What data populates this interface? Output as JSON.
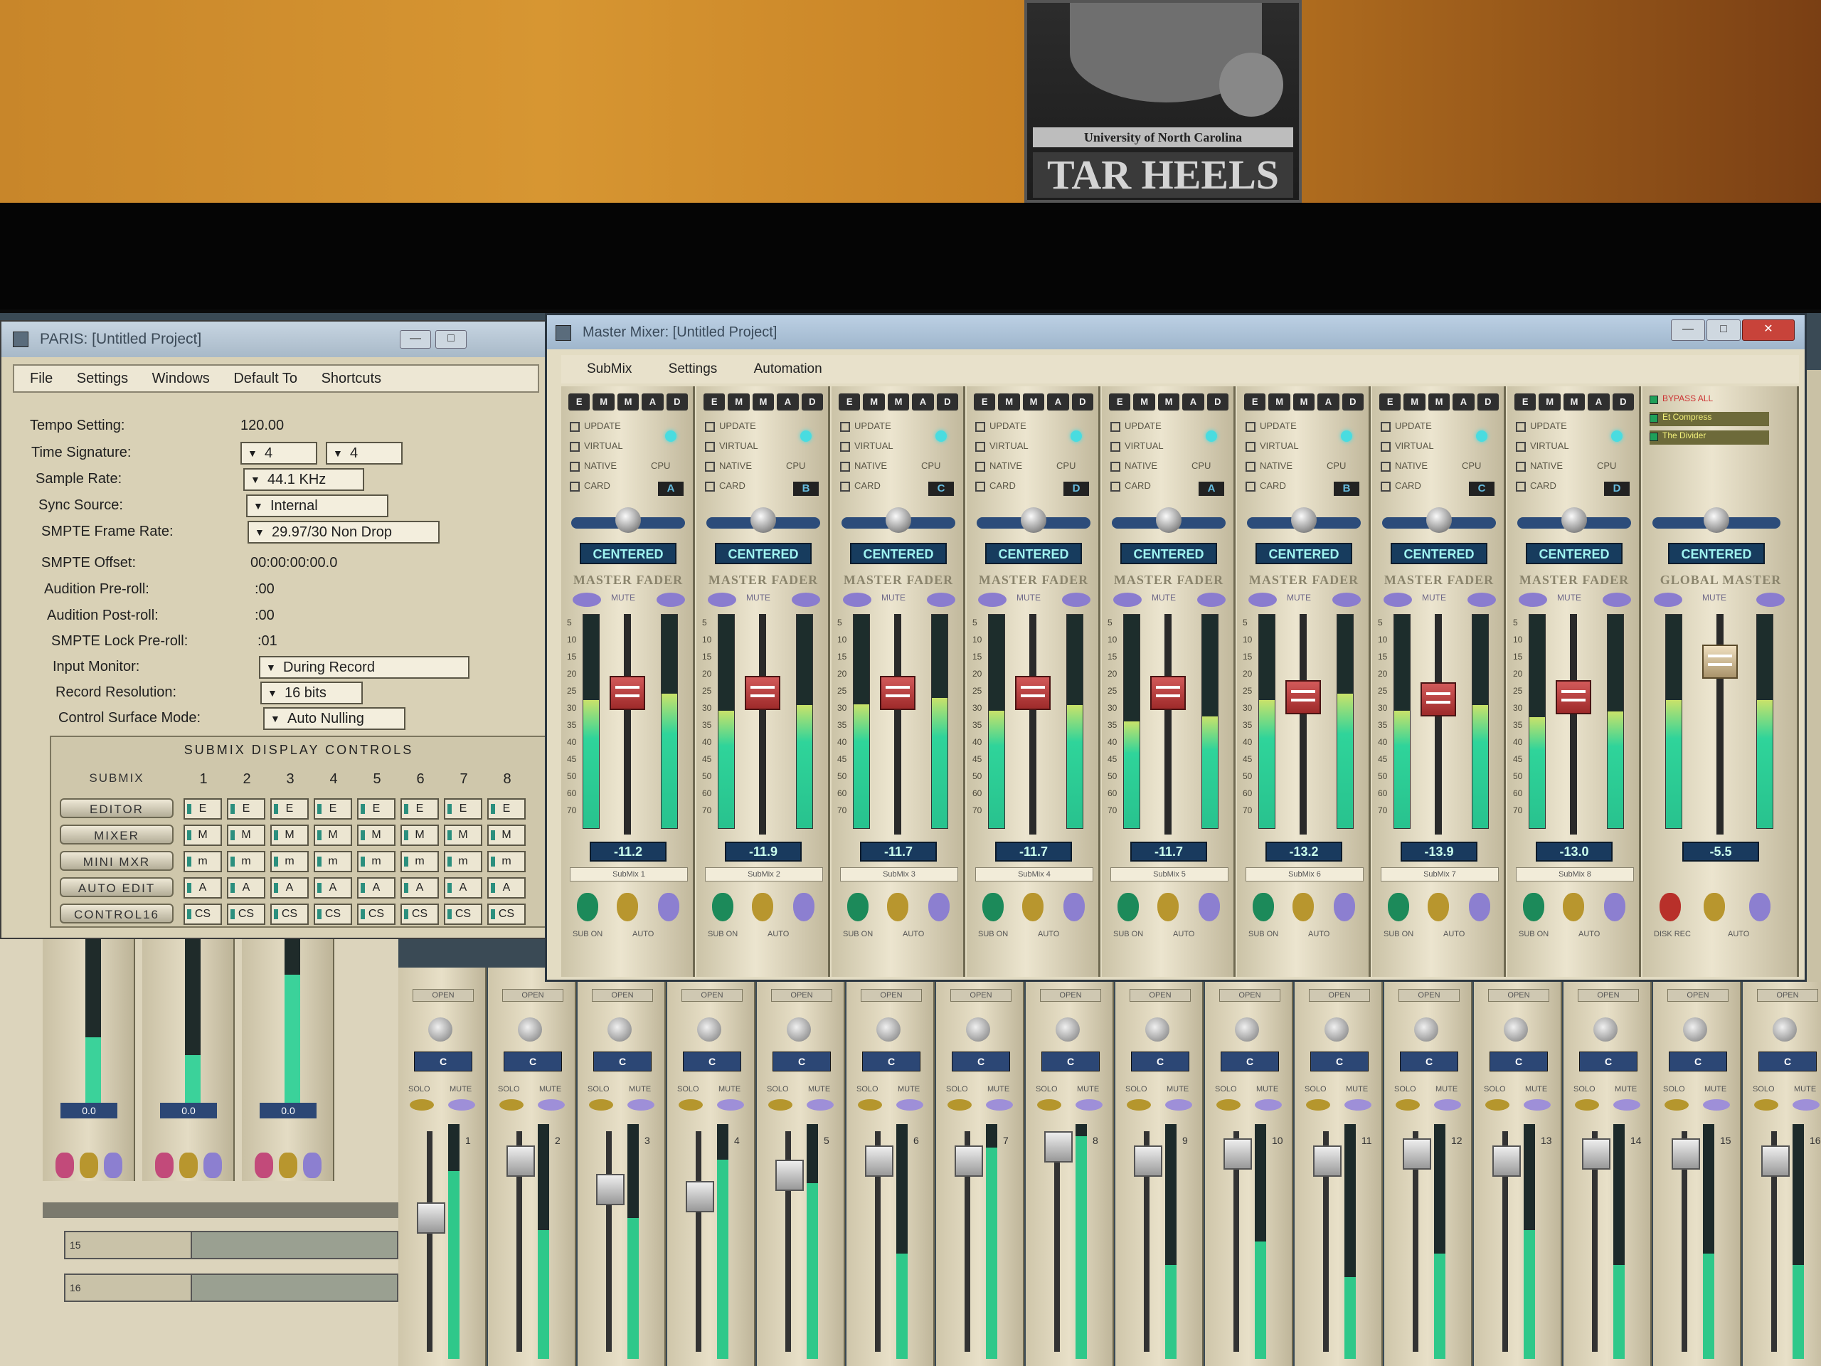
{
  "photo": {
    "poster": {
      "line1": "University of North Carolina",
      "line2": "TAR HEELS"
    }
  },
  "paris_window": {
    "title": "PARIS: [Untitled Project]",
    "controls": {
      "minimize": "—",
      "maximize": "□"
    },
    "menu": [
      "File",
      "Settings",
      "Windows",
      "Default To",
      "Shortcuts"
    ],
    "settings": [
      {
        "label": "Tempo Setting:",
        "value": "120.00",
        "kind": "text"
      },
      {
        "label": "Time Signature:",
        "value": "4",
        "value2": "4",
        "kind": "dual"
      },
      {
        "label": "Sample Rate:",
        "value": "44.1 KHz",
        "kind": "dropdown"
      },
      {
        "label": "Sync Source:",
        "value": "Internal",
        "kind": "dropdown"
      },
      {
        "label": "SMPTE Frame Rate:",
        "value": "29.97/30 Non Drop",
        "kind": "dropdown"
      },
      {
        "label": "SMPTE Offset:",
        "value": "00:00:00:00.0",
        "kind": "text"
      },
      {
        "label": "Audition Pre-roll:",
        "value": ":00",
        "kind": "text"
      },
      {
        "label": "Audition Post-roll:",
        "value": ":00",
        "kind": "text"
      },
      {
        "label": "SMPTE Lock Pre-roll:",
        "value": ":01",
        "kind": "text"
      },
      {
        "label": "Input Monitor:",
        "value": "During Record",
        "kind": "dropdown"
      },
      {
        "label": "Record Resolution:",
        "value": "16 bits",
        "kind": "dropdown"
      },
      {
        "label": "Control Surface Mode:",
        "value": "Auto Nulling",
        "kind": "dropdown"
      }
    ],
    "submix_panel": {
      "header": "SUBMIX  DISPLAY  CONTROLS",
      "row_header": "SUBMIX",
      "columns": [
        "1",
        "2",
        "3",
        "4",
        "5",
        "6",
        "7",
        "8"
      ],
      "rows": [
        {
          "label": "EDITOR",
          "cell": "E"
        },
        {
          "label": "MIXER",
          "cell": "M"
        },
        {
          "label": "MINI MXR",
          "cell": "m"
        },
        {
          "label": "AUTO EDIT",
          "cell": "A"
        },
        {
          "label": "CONTROL16",
          "cell": "CS"
        }
      ]
    }
  },
  "master_window": {
    "title": "Master Mixer: [Untitled Project]",
    "controls": {
      "minimize": "—",
      "maximize": "□",
      "close": "✕"
    },
    "menu": [
      "SubMix",
      "Settings",
      "Automation"
    ],
    "emmad": [
      "E",
      "M",
      "M",
      "A",
      "D"
    ],
    "options": [
      "UPDATE",
      "VIRTUAL",
      "NATIVE",
      "CARD"
    ],
    "cpu_label": "CPU",
    "pan_label": "CENTERED",
    "fader_title": "MASTER FADER",
    "mute_label": "MUTE",
    "scale": [
      "5",
      "10",
      "15",
      "20",
      "25",
      "30",
      "35",
      "40",
      "45",
      "50",
      "60",
      "70"
    ],
    "sub_on_label": "SUB ON",
    "auto_label": "AUTO",
    "strips": [
      {
        "card": "A",
        "db": "-11.2",
        "name": "SubMix 1",
        "fader_level": 0.72,
        "meter_level": 0.6
      },
      {
        "card": "B",
        "db": "-11.9",
        "name": "SubMix 2",
        "fader_level": 0.72,
        "meter_level": 0.55
      },
      {
        "card": "C",
        "db": "-11.7",
        "name": "SubMix 3",
        "fader_level": 0.72,
        "meter_level": 0.58
      },
      {
        "card": "D",
        "db": "-11.7",
        "name": "SubMix 4",
        "fader_level": 0.72,
        "meter_level": 0.55
      },
      {
        "card": "A",
        "db": "-11.7",
        "name": "SubMix 5",
        "fader_level": 0.72,
        "meter_level": 0.5
      },
      {
        "card": "B",
        "db": "-13.2",
        "name": "SubMix 6",
        "fader_level": 0.7,
        "meter_level": 0.6
      },
      {
        "card": "C",
        "db": "-13.9",
        "name": "SubMix 7",
        "fader_level": 0.69,
        "meter_level": 0.55
      },
      {
        "card": "D",
        "db": "-13.0",
        "name": "SubMix 8",
        "fader_level": 0.7,
        "meter_level": 0.52
      }
    ],
    "global": {
      "title": "GLOBAL MASTER",
      "db": "-5.5",
      "fader_level": 0.86,
      "meter_level": 0.6,
      "list": [
        "BYPASS ALL",
        "Et Compress",
        "The Divider"
      ],
      "disk_rec_label": "DISK REC"
    }
  },
  "bg_mixer": {
    "open_label": "OPEN",
    "solo_label": "SOLO",
    "mute_label": "MUTE",
    "pan": "C",
    "channels": [
      "1",
      "2",
      "3",
      "4",
      "5",
      "6",
      "7",
      "8",
      "9",
      "10",
      "11",
      "12",
      "13",
      "14",
      "15",
      "16"
    ]
  },
  "bl_area": {
    "values": [
      "0.0",
      "0.0",
      "0.0"
    ],
    "tracks": [
      "15",
      "16"
    ]
  }
}
